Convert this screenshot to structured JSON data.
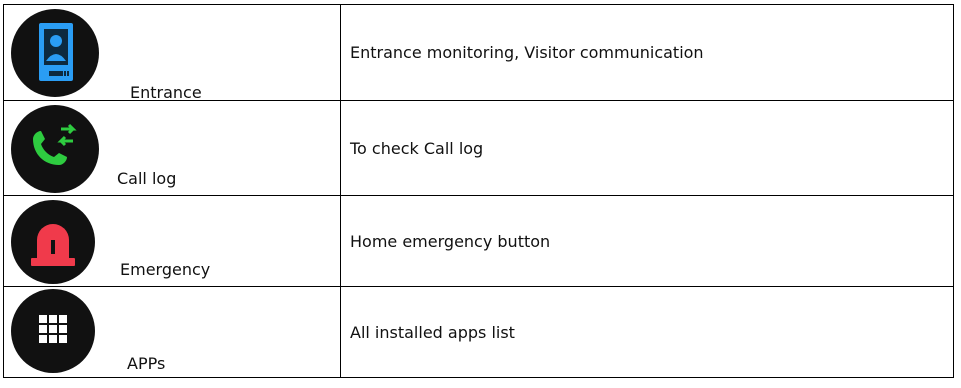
{
  "rows": [
    {
      "icon": "entrance-door-phone-icon",
      "label": "Entrance",
      "description": "Entrance monitoring, Visitor communication"
    },
    {
      "icon": "call-log-icon",
      "label": "Call log",
      "description": "To check Call log"
    },
    {
      "icon": "emergency-siren-icon",
      "label": "Emergency",
      "description": "Home emergency button"
    },
    {
      "icon": "apps-grid-icon",
      "label": "APPs",
      "description": "All installed apps list"
    }
  ],
  "colors": {
    "icon_background": "#111111",
    "entrance_accent": "#2a9df4",
    "call_log_accent": "#2ecc40",
    "emergency_accent": "#f03a4b",
    "apps_accent": "#ffffff"
  }
}
